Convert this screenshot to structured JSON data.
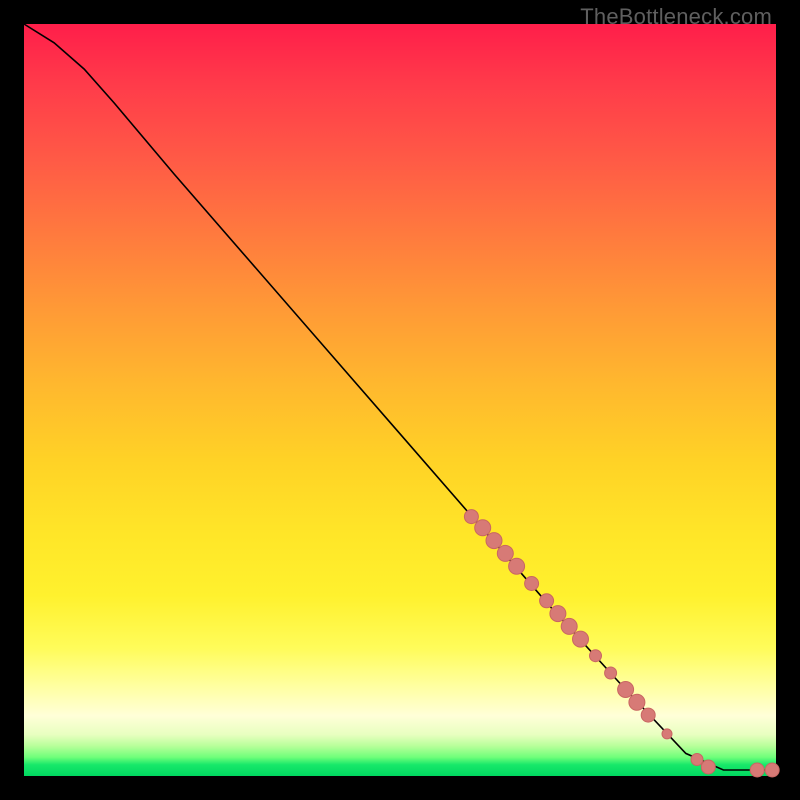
{
  "watermark": "TheBottleneck.com",
  "colors": {
    "point_fill": "#d77a76",
    "point_stroke": "#c96662",
    "curve_stroke": "#000000",
    "background_frame": "#000000"
  },
  "chart_data": {
    "type": "line",
    "title": "",
    "xlabel": "",
    "ylabel": "",
    "xlim": [
      0,
      100
    ],
    "ylim": [
      0,
      100
    ],
    "curve": [
      {
        "x": 0,
        "y": 100
      },
      {
        "x": 4,
        "y": 97.5
      },
      {
        "x": 8,
        "y": 94
      },
      {
        "x": 12,
        "y": 89.5
      },
      {
        "x": 20,
        "y": 80
      },
      {
        "x": 30,
        "y": 68.5
      },
      {
        "x": 40,
        "y": 57
      },
      {
        "x": 50,
        "y": 45.5
      },
      {
        "x": 60,
        "y": 34
      },
      {
        "x": 70,
        "y": 22.5
      },
      {
        "x": 80,
        "y": 11.5
      },
      {
        "x": 88,
        "y": 3
      },
      {
        "x": 93,
        "y": 0.8
      },
      {
        "x": 100,
        "y": 0.8
      }
    ],
    "series": [
      {
        "name": "points",
        "points": [
          {
            "x": 59.5,
            "y": 34.5,
            "r": 7
          },
          {
            "x": 61.0,
            "y": 33.0,
            "r": 8
          },
          {
            "x": 62.5,
            "y": 31.3,
            "r": 8
          },
          {
            "x": 64.0,
            "y": 29.6,
            "r": 8
          },
          {
            "x": 65.5,
            "y": 27.9,
            "r": 8
          },
          {
            "x": 67.5,
            "y": 25.6,
            "r": 7
          },
          {
            "x": 69.5,
            "y": 23.3,
            "r": 7
          },
          {
            "x": 71.0,
            "y": 21.6,
            "r": 8
          },
          {
            "x": 72.5,
            "y": 19.9,
            "r": 8
          },
          {
            "x": 74.0,
            "y": 18.2,
            "r": 8
          },
          {
            "x": 76.0,
            "y": 16.0,
            "r": 6
          },
          {
            "x": 78.0,
            "y": 13.7,
            "r": 6
          },
          {
            "x": 80.0,
            "y": 11.5,
            "r": 8
          },
          {
            "x": 81.5,
            "y": 9.8,
            "r": 8
          },
          {
            "x": 83.0,
            "y": 8.1,
            "r": 7
          },
          {
            "x": 85.5,
            "y": 5.6,
            "r": 5
          },
          {
            "x": 89.5,
            "y": 2.2,
            "r": 6
          },
          {
            "x": 91.0,
            "y": 1.2,
            "r": 7
          },
          {
            "x": 97.5,
            "y": 0.8,
            "r": 7
          },
          {
            "x": 99.5,
            "y": 0.8,
            "r": 7
          }
        ]
      }
    ]
  }
}
